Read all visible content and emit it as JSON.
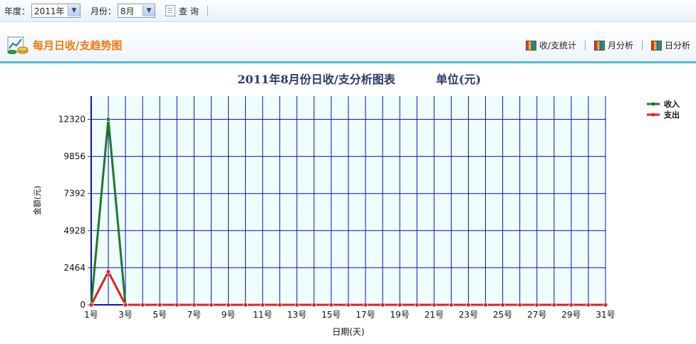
{
  "toolbar": {
    "year_label": "年度：",
    "year_value": "2011年",
    "month_label": "月份：",
    "month_value": "8月",
    "query_label": "查 询"
  },
  "section": {
    "title": "每月日收/支趋势图",
    "nav": [
      "收/支统计",
      "月分析",
      "日分析"
    ]
  },
  "colors": {
    "income": "#1e7a23",
    "expense": "#e02020",
    "grid": "#1010c0",
    "plot_bg": "#effdfe",
    "title": "#2a3a6a"
  },
  "chart_data": {
    "type": "line",
    "title": "2011年8月份日收/支分析图表",
    "unit": "单位(元)",
    "xlabel": "日期(天)",
    "ylabel": "金额(元)",
    "ylim": [
      0,
      13858
    ],
    "yticks": [
      0,
      2464,
      4928,
      7392,
      9856,
      12320
    ],
    "x": [
      1,
      2,
      3,
      4,
      5,
      6,
      7,
      8,
      9,
      10,
      11,
      12,
      13,
      14,
      15,
      16,
      17,
      18,
      19,
      20,
      21,
      22,
      23,
      24,
      25,
      26,
      27,
      28,
      29,
      30,
      31
    ],
    "x_tick_labels": [
      "1号",
      "3号",
      "5号",
      "7号",
      "9号",
      "11号",
      "13号",
      "15号",
      "17号",
      "19号",
      "21号",
      "23号",
      "25号",
      "27号",
      "29号",
      "31号"
    ],
    "x_tick_values": [
      1,
      3,
      5,
      7,
      9,
      11,
      13,
      15,
      17,
      19,
      21,
      23,
      25,
      27,
      29,
      31
    ],
    "series": [
      {
        "name": "收入",
        "values": [
          0,
          12320,
          0,
          0,
          0,
          0,
          0,
          0,
          0,
          0,
          0,
          0,
          0,
          0,
          0,
          0,
          0,
          0,
          0,
          0,
          0,
          0,
          0,
          0,
          0,
          0,
          0,
          0,
          0,
          0,
          0
        ]
      },
      {
        "name": "支出",
        "values": [
          0,
          2200,
          0,
          0,
          0,
          0,
          0,
          0,
          0,
          0,
          0,
          0,
          0,
          0,
          0,
          0,
          0,
          0,
          0,
          0,
          0,
          0,
          0,
          0,
          0,
          0,
          0,
          0,
          0,
          0,
          0
        ]
      }
    ],
    "grid": true,
    "legend_position": "top-right"
  }
}
